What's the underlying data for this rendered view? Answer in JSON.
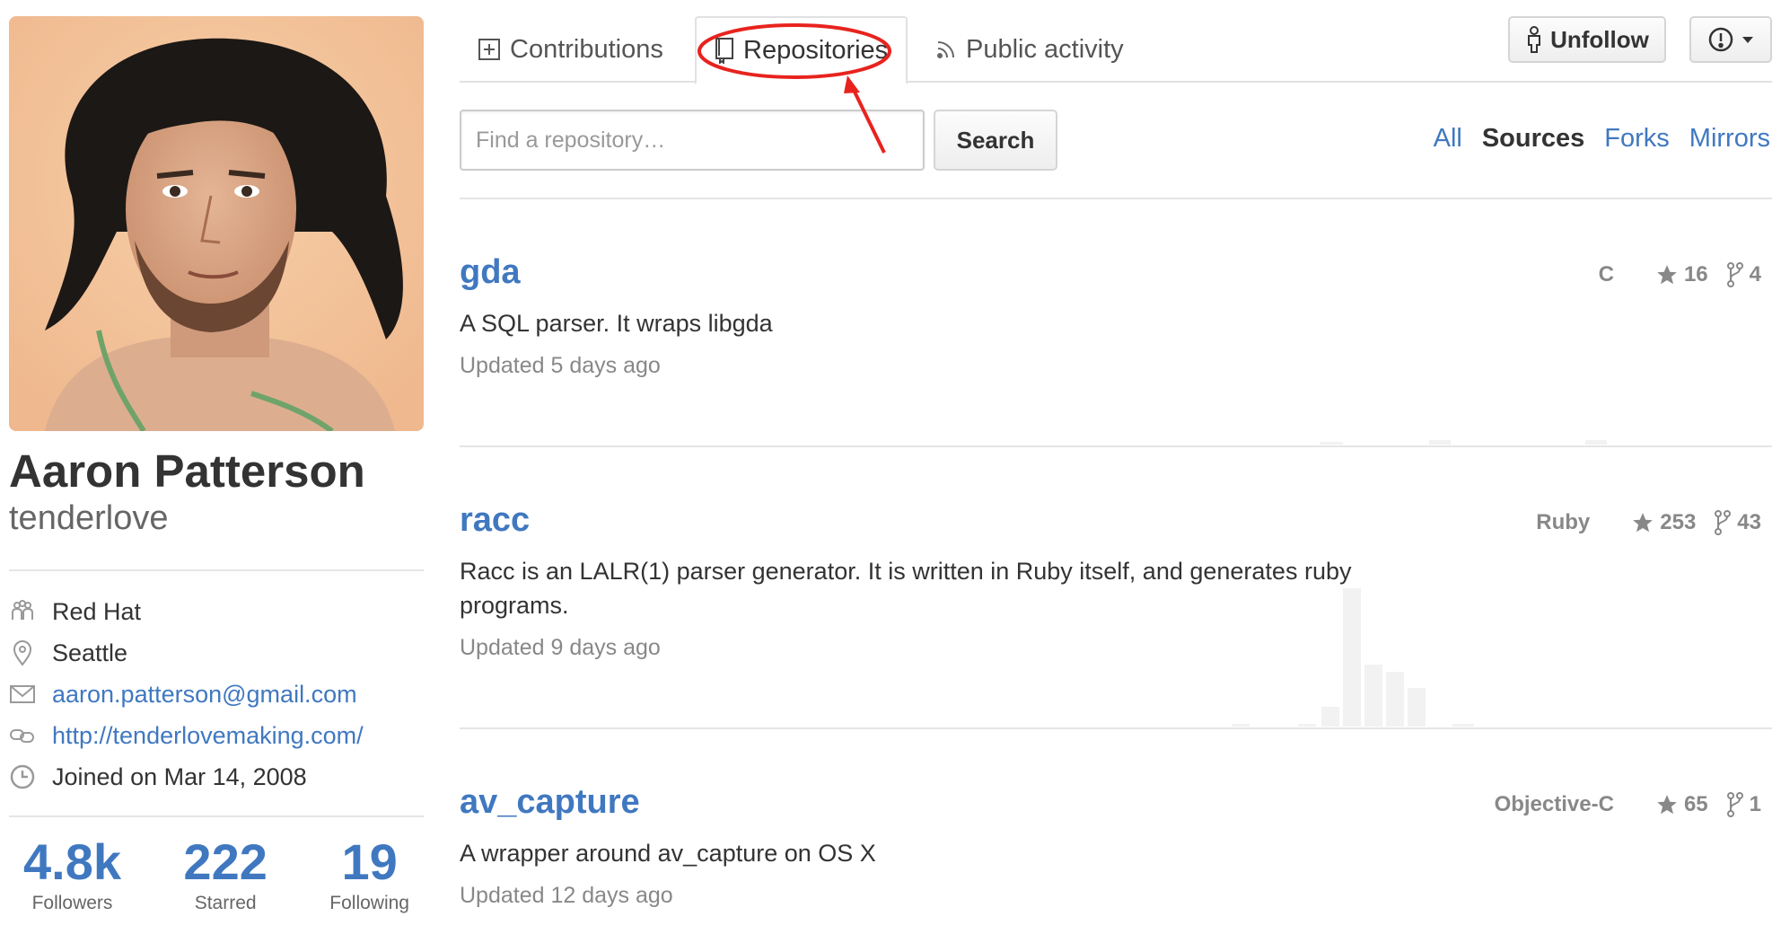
{
  "profile": {
    "fullname": "Aaron Patterson",
    "username": "tenderlove",
    "organization": "Red Hat",
    "location": "Seattle",
    "email": "aaron.patterson@gmail.com",
    "website": "http://tenderlovemaking.com/",
    "joined": "Joined on Mar 14, 2008",
    "stats": [
      {
        "value": "4.8k",
        "label": "Followers"
      },
      {
        "value": "222",
        "label": "Starred"
      },
      {
        "value": "19",
        "label": "Following"
      }
    ]
  },
  "tabs": [
    {
      "label": "Contributions",
      "icon": "plus-square-icon"
    },
    {
      "label": "Repositories",
      "icon": "repo-icon",
      "active": true
    },
    {
      "label": "Public activity",
      "icon": "rss-icon"
    }
  ],
  "actions": {
    "unfollow_label": "Unfollow",
    "report_icon": "alert-icon"
  },
  "search": {
    "placeholder": "Find a repository…",
    "button_label": "Search"
  },
  "filters": [
    {
      "label": "All"
    },
    {
      "label": "Sources",
      "active": true
    },
    {
      "label": "Forks"
    },
    {
      "label": "Mirrors"
    }
  ],
  "repos": [
    {
      "name": "gda",
      "description": "A SQL parser. It wraps libgda",
      "updated": "Updated 5 days ago",
      "language": "C",
      "stars": "16",
      "forks": "4"
    },
    {
      "name": "racc",
      "description": "Racc is an LALR(1) parser generator. It is written in Ruby itself, and generates ruby programs.",
      "updated": "Updated 9 days ago",
      "language": "Ruby",
      "stars": "253",
      "forks": "43"
    },
    {
      "name": "av_capture",
      "description": "A wrapper around av_capture on OS X",
      "updated": "Updated 12 days ago",
      "language": "Objective-C",
      "stars": "65",
      "forks": "1"
    }
  ],
  "colors": {
    "link": "#4078c0",
    "annotation": "#e8231e"
  }
}
